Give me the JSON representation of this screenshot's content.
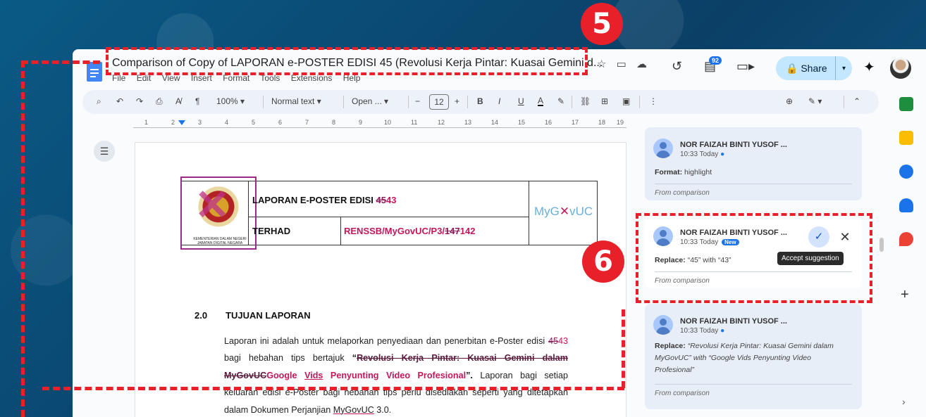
{
  "doc": {
    "title": "Comparison of Copy of LAPORAN e-POSTER EDISI 45 (Revolusi Kerja Pintar: Kuasai Gemini d...",
    "menu": [
      "File",
      "Edit",
      "View",
      "Insert",
      "Format",
      "Tools",
      "Extensions",
      "Help"
    ],
    "title_icons": [
      "star-icon",
      "move-folder-icon",
      "cloud-status-icon"
    ],
    "comment_count": "92",
    "share_label": "Share"
  },
  "toolbar": {
    "zoom": "100%",
    "style": "Normal text",
    "font": "Open ...",
    "font_size": "12",
    "bold": "B",
    "italic": "I",
    "underline": "U",
    "text_color": "A"
  },
  "ruler": [
    "1",
    "2",
    "3",
    "4",
    "5",
    "6",
    "7",
    "8",
    "9",
    "10",
    "11",
    "12",
    "13",
    "14",
    "15",
    "16",
    "17",
    "18",
    "19"
  ],
  "page": {
    "header": {
      "logo_caption": "KEMENTERIAN DALAM NEGERI JABATAN DIGITAL NEGARA",
      "row1_label": "LAPORAN E-POSTER EDISI ",
      "row1_del": "45",
      "row1_ins": "43",
      "row2_label": "TERHAD",
      "row2_prefix": "RENSSB/MyGovUC/P3/",
      "row2_del": "147",
      "row2_ins": "142",
      "brand_left": "MyG",
      "brand_x": "✕",
      "brand_right": "vUC"
    },
    "section_number": "2.0",
    "section_title": "TUJUAN LAPORAN",
    "paragraph": {
      "p1": "Laporan ini adalah untuk melaporkan penyediaan dan penerbitan e-Poster edisi ",
      "del1": "45",
      "ins1": "43",
      "p2": " bagi hebahan tips bertajuk ",
      "quote_open": "“",
      "del2": "Revolusi Kerja Pintar: Kuasai Gemini dalam MyGovUC",
      "ins2a": "Google ",
      "ins2b": "Vids",
      "ins2c": " Penyunting Video Profesional",
      "quote_close": "”.",
      "p3": " Laporan bagi setiap keluaran edisi e-Poster bagi hebahan tips perlu disediakan seperti yang ditetapkan dalam Dokumen Perjanjian ",
      "p3_link": "MyGovUC",
      "p3_end": " 3.0."
    }
  },
  "comments": [
    {
      "author": "NOR FAIZAH BINTI YUSOF ...",
      "time": "10:33 Today",
      "body_label": "Format:",
      "body_text": " highlight",
      "footer": "From comparison"
    },
    {
      "author": "NOR FAIZAH BINTI YUSOF ...",
      "time": "10:33 Today",
      "badge": "New",
      "body_label": "Replace:",
      "body_text": " “45” with “43”",
      "footer": "From comparison",
      "tooltip": "Accept suggestion"
    },
    {
      "author": "NOR FAIZAH BINTI YUSOF ...",
      "time": "10:33 Today",
      "body_label": "Replace:",
      "body_text": " “Revolusi Kerja Pintar: Kuasai Gemini dalam MyGovUC” with “Google Vids Penyunting Video Profesional”",
      "footer": "From comparison"
    }
  ],
  "annotations": {
    "step5": "5",
    "step6": "6",
    "color": "#e8202a"
  },
  "colors": {
    "insert": "#c2185b",
    "share_bg": "#c2e7ff",
    "accent": "#1a73e8"
  }
}
